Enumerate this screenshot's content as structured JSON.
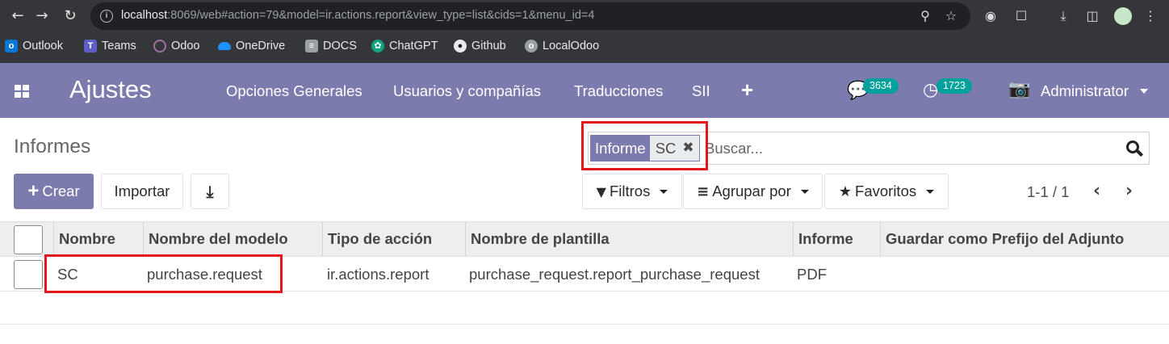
{
  "browser": {
    "url_host": "localhost",
    "url_rest": ":8069/web#action=79&model=ir.actions.report&view_type=list&cids=1&menu_id=4",
    "bookmarks": [
      {
        "label": "Outlook",
        "icon": "outlook-icon",
        "color": "#0078d4"
      },
      {
        "label": "Teams",
        "icon": "teams-icon",
        "color": "#5b5fc7"
      },
      {
        "label": "Odoo",
        "icon": "odoo-icon",
        "color": "#a06fa0"
      },
      {
        "label": "OneDrive",
        "icon": "onedrive-icon",
        "color": "#1e90ff"
      },
      {
        "label": "DOCS",
        "icon": "docs-icon",
        "color": "#9aa0a6"
      },
      {
        "label": "ChatGPT",
        "icon": "chatgpt-icon",
        "color": "#10a37f"
      },
      {
        "label": "Github",
        "icon": "github-icon",
        "color": "#e8eaed"
      },
      {
        "label": "LocalOdoo",
        "icon": "localodoo-icon",
        "color": "#9aa0a6"
      }
    ]
  },
  "navbar": {
    "app_name": "Ajustes",
    "menu": [
      "Opciones Generales",
      "Usuarios y compañías",
      "Traducciones",
      "SII"
    ],
    "messages_count": "3634",
    "activities_count": "1723",
    "user_name": "Administrator",
    "color": "#7c7bad",
    "badge_color": "#00a09d"
  },
  "control_panel": {
    "title": "Informes",
    "create_label": "Crear",
    "import_label": "Importar",
    "filters_label": "Filtros",
    "groupby_label": "Agrupar por",
    "favorites_label": "Favoritos",
    "pager_value": "1-1 / 1",
    "search": {
      "facet_category": "Informe",
      "facet_value": "SC",
      "placeholder": "Buscar..."
    }
  },
  "list": {
    "columns": [
      "Nombre",
      "Nombre del modelo",
      "Tipo de acción",
      "Nombre de plantilla",
      "Informe",
      "Guardar como Prefijo del Adjunto"
    ],
    "rows": [
      [
        "SC",
        "purchase.request",
        "ir.actions.report",
        "purchase_request.report_purchase_request",
        "PDF",
        ""
      ]
    ]
  },
  "highlight_color": "#e5151c"
}
